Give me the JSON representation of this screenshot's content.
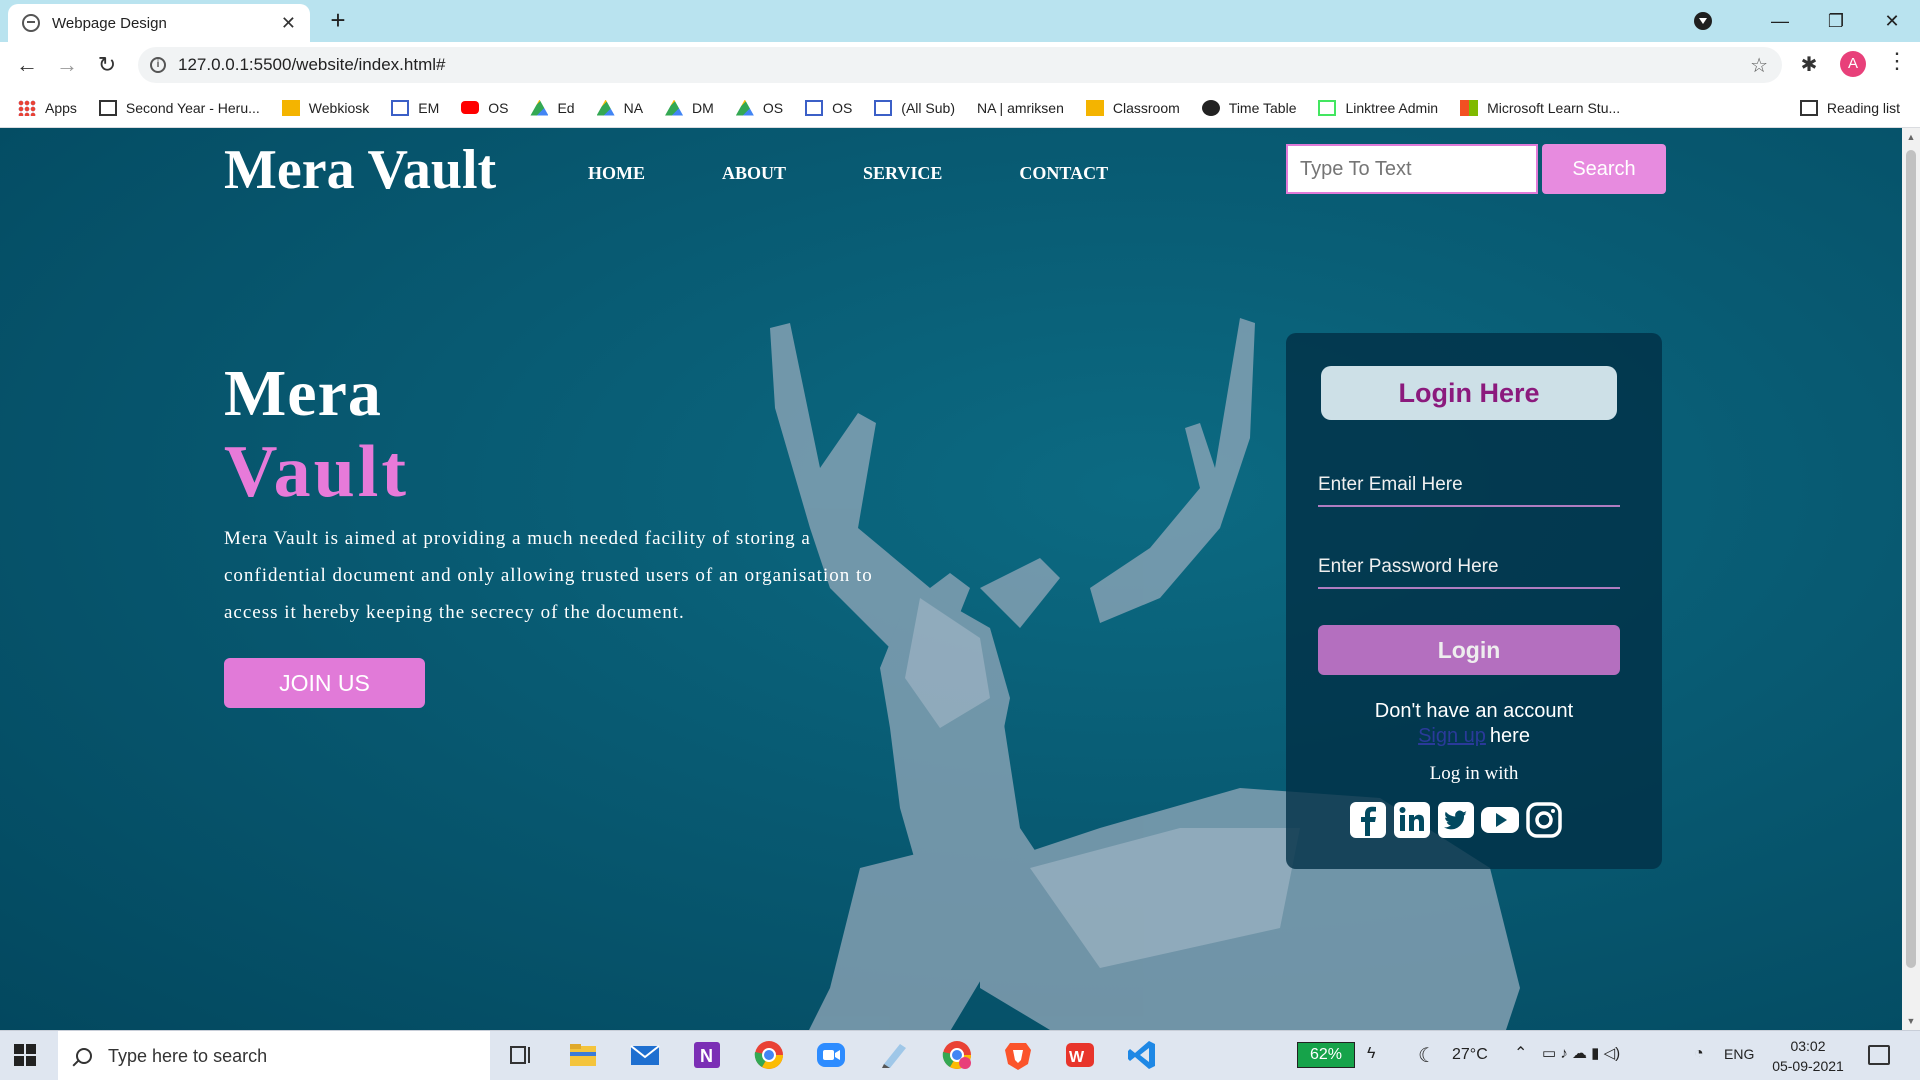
{
  "browser": {
    "tab_title": "Webpage Design",
    "url": "127.0.0.1:5500/website/index.html#",
    "profile_initial": "A",
    "bookmarks": [
      {
        "label": "Apps",
        "icon": "apps-grid-icon"
      },
      {
        "label": "Second Year - Heru...",
        "icon": "site-icon"
      },
      {
        "label": "Webkiosk",
        "icon": "webkiosk-icon"
      },
      {
        "label": "EM",
        "icon": "calendar-icon"
      },
      {
        "label": "OS",
        "icon": "youtube-icon"
      },
      {
        "label": "Ed",
        "icon": "drive-icon"
      },
      {
        "label": "NA",
        "icon": "drive-icon"
      },
      {
        "label": "DM",
        "icon": "drive-icon"
      },
      {
        "label": "OS",
        "icon": "drive-icon"
      },
      {
        "label": "OS",
        "icon": "calendar-icon"
      },
      {
        "label": "(All Sub)",
        "icon": "calendar-icon"
      },
      {
        "label": "NA | amriksen",
        "icon": ""
      },
      {
        "label": "Classroom",
        "icon": "classroom-icon"
      },
      {
        "label": "Time Table",
        "icon": "globe-icon"
      },
      {
        "label": "Linktree Admin",
        "icon": "linktree-icon"
      },
      {
        "label": "Microsoft Learn Stu...",
        "icon": "microsoft-icon"
      }
    ],
    "reading_list": "Reading list"
  },
  "page": {
    "logo": "Mera Vault",
    "nav": [
      "HOME",
      "ABOUT",
      "SERVICE",
      "CONTACT"
    ],
    "search_placeholder": "Type To Text",
    "search_button": "Search",
    "hero_title_1": "Mera",
    "hero_title_2": "Vault",
    "hero_description": "Mera Vault is aimed at providing a much needed facility of storing a confidential document and only allowing trusted users of an organisation to access it hereby keeping the secrecy of the document.",
    "join_button": "JOIN US",
    "colors": {
      "accent_pink": "#e17ad8",
      "login_purple": "#8b1a7d",
      "bg_teal": "#085a72"
    }
  },
  "login": {
    "heading": "Login Here",
    "email_placeholder": "Enter Email Here",
    "password_placeholder": "Enter Password Here",
    "button": "Login",
    "no_account": "Don't have an account",
    "signup_link": "Sign up",
    "signup_suffix": "here",
    "login_with": "Log in with",
    "socials": [
      "facebook-icon",
      "linkedin-icon",
      "twitter-icon",
      "youtube-icon",
      "instagram-icon"
    ]
  },
  "taskbar": {
    "search_placeholder": "Type here to search",
    "battery": "62%",
    "temperature": "27°C",
    "language": "ENG",
    "time": "03:02",
    "date": "05-09-2021"
  }
}
